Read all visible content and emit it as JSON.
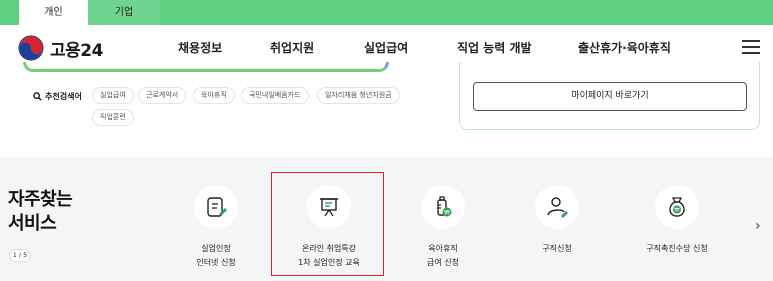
{
  "top_tabs": {
    "personal": "개인",
    "business": "기업"
  },
  "header": {
    "logo_text": "고용24",
    "nav": [
      "채용정보",
      "취업지원",
      "실업급여",
      "직업 능력 개발",
      "출산휴가·육아휴직"
    ]
  },
  "recommend": {
    "label": "추천검색어",
    "tags": [
      "실업급여",
      "근로계약서",
      "육아휴직",
      "국민내일배움카드",
      "일자리채움 청년지원금",
      "직업훈련"
    ]
  },
  "mypage_button": "마이페이지 바로가기",
  "services": {
    "title_line1": "자주찾는",
    "title_line2": "서비스",
    "pager": "1 / 5",
    "items": [
      {
        "line1": "실업인정",
        "line2": "인터넷 신청",
        "icon": "document-pen-icon"
      },
      {
        "line1": "온라인 취업특강",
        "line2": "1차 실업인정 교육",
        "icon": "presentation-board-icon"
      },
      {
        "line1": "육아휴직",
        "line2": "급여 신청",
        "icon": "baby-bottle-icon"
      },
      {
        "line1": "구직신청",
        "line2": "",
        "icon": "person-pen-icon"
      },
      {
        "line1": "구직촉진수당 신청",
        "line2": "",
        "icon": "money-bag-icon"
      }
    ]
  },
  "colors": {
    "green": "#5fcf82",
    "highlight": "#e02020",
    "icon_green": "#2f9e5a"
  }
}
